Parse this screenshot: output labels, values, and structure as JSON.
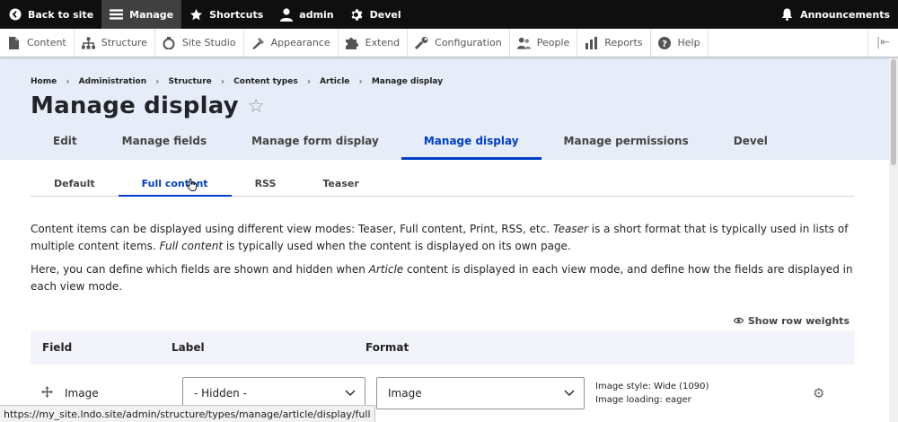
{
  "toolbar": {
    "back_to_site": "Back to site",
    "manage": "Manage",
    "shortcuts": "Shortcuts",
    "user": "admin",
    "devel": "Devel",
    "announcements": "Announcements"
  },
  "tray": {
    "items": [
      {
        "label": "Content",
        "icon": "content-icon"
      },
      {
        "label": "Structure",
        "icon": "structure-icon"
      },
      {
        "label": "Site Studio",
        "icon": "site-studio-icon"
      },
      {
        "label": "Appearance",
        "icon": "appearance-icon"
      },
      {
        "label": "Extend",
        "icon": "extend-icon"
      },
      {
        "label": "Configuration",
        "icon": "configuration-icon"
      },
      {
        "label": "People",
        "icon": "people-icon"
      },
      {
        "label": "Reports",
        "icon": "reports-icon"
      },
      {
        "label": "Help",
        "icon": "help-icon"
      }
    ]
  },
  "breadcrumb": [
    "Home",
    "Administration",
    "Structure",
    "Content types",
    "Article",
    "Manage display"
  ],
  "page": {
    "title": "Manage display"
  },
  "primary_tabs": [
    "Edit",
    "Manage fields",
    "Manage form display",
    "Manage display",
    "Manage permissions",
    "Devel"
  ],
  "secondary_tabs": [
    "Default",
    "Full content",
    "RSS",
    "Teaser"
  ],
  "description": {
    "p1_a": "Content items can be displayed using different view modes: Teaser, Full content, Print, RSS, etc. ",
    "p1_em1": "Teaser",
    "p1_b": " is a short format that is typically used in lists of multiple content items. ",
    "p1_em2": "Full content",
    "p1_c": " is typically used when the content is displayed on its own page.",
    "p2_a": "Here, you can define which fields are shown and hidden when ",
    "p2_em": "Article",
    "p2_b": " content is displayed in each view mode, and define how the fields are displayed in each view mode."
  },
  "show_row_weights": "Show row weights",
  "table": {
    "headers": {
      "field": "Field",
      "label": "Label",
      "format": "Format"
    },
    "rows": [
      {
        "field": "Image",
        "label": "- Hidden -",
        "format": "Image",
        "summary1": "Image style: Wide (1090)",
        "summary2": "Image loading: eager"
      }
    ]
  },
  "status_url": "https://my_site.lndo.site/admin/structure/types/manage/article/display/full",
  "colors": {
    "accent": "#003ecc",
    "header_bg": "#e6ecf8",
    "toolbar_bg": "#0f0f0f"
  }
}
